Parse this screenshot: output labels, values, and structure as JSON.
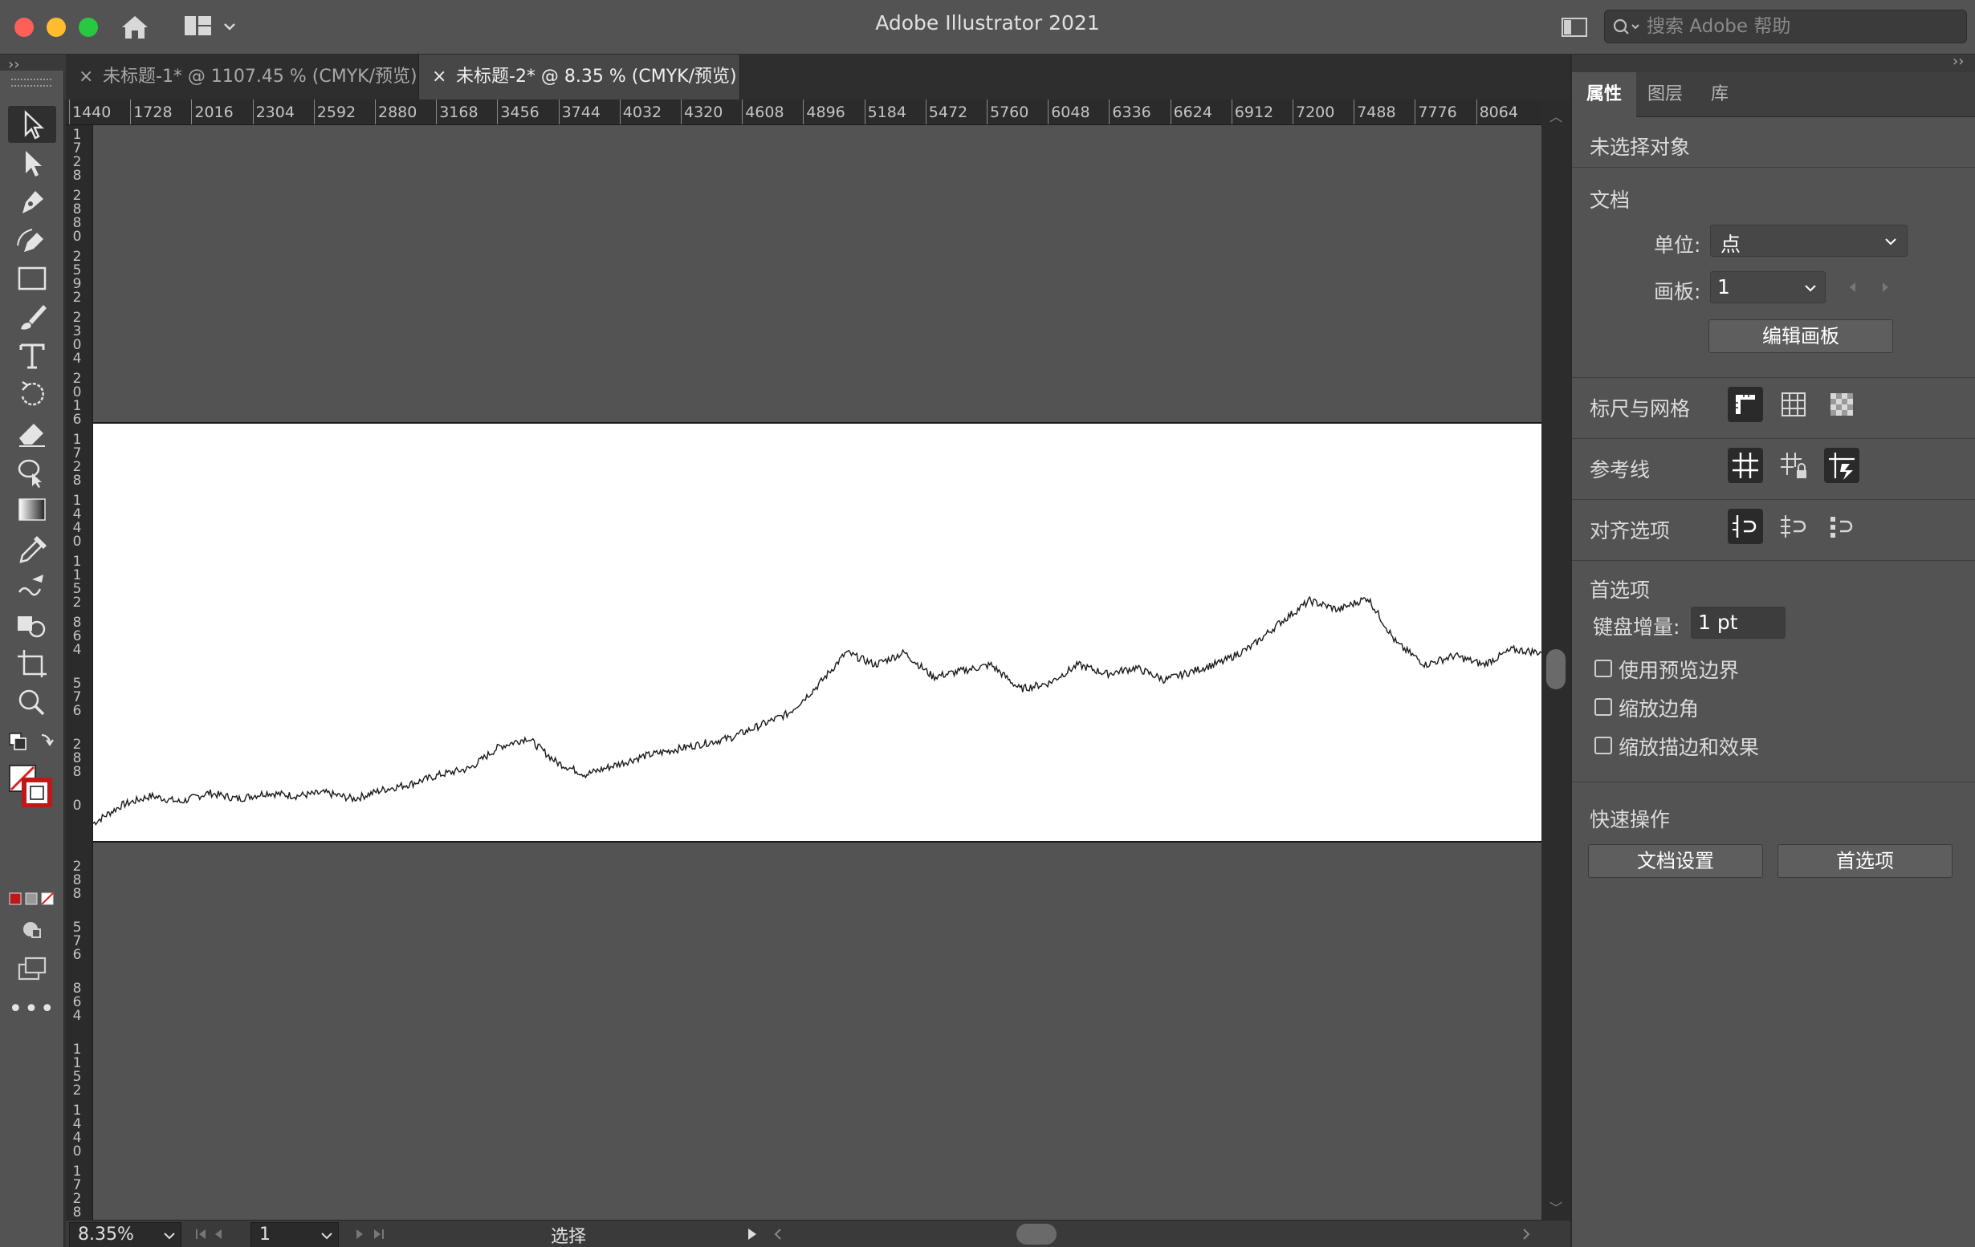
{
  "app": {
    "title": "Adobe Illustrator 2021",
    "search_placeholder": "搜索 Adobe 帮助"
  },
  "tabs": [
    {
      "label": "未标题-1* @ 1107.45 % (CMYK/预览)",
      "active": false
    },
    {
      "label": "未标题-2* @ 8.35 % (CMYK/预览)",
      "active": true
    }
  ],
  "ruler_top": [
    "1440",
    "1728",
    "2016",
    "2304",
    "2592",
    "2880",
    "3168",
    "3456",
    "3744",
    "4032",
    "4320",
    "4608",
    "4896",
    "5184",
    "5472",
    "5760",
    "6048",
    "6336",
    "6624",
    "6912",
    "7200",
    "7488",
    "7776",
    "8064"
  ],
  "ruler_left": [
    "1728",
    "2880",
    "2592",
    "2304",
    "2016",
    "1728",
    "1440",
    "1152",
    "864",
    "576",
    "288",
    "0",
    "288",
    "576",
    "864",
    "1152",
    "1440",
    "1728"
  ],
  "chart_data": {
    "type": "line",
    "series": [
      {
        "x": [
          0,
          2,
          4,
          6,
          8,
          10,
          12,
          14,
          16,
          18,
          20,
          22,
          24,
          26,
          28,
          30,
          32,
          34,
          36,
          38,
          40,
          42,
          44,
          46,
          48,
          50,
          52,
          54,
          56,
          58,
          60,
          62,
          64,
          66,
          68,
          70,
          72,
          74,
          76,
          78,
          80,
          82,
          84,
          86,
          88,
          90,
          92,
          94,
          96,
          98,
          100
        ],
        "values": [
          0.0,
          0.06,
          0.09,
          0.07,
          0.1,
          0.08,
          0.1,
          0.09,
          0.1,
          0.08,
          0.11,
          0.13,
          0.16,
          0.18,
          0.25,
          0.28,
          0.2,
          0.16,
          0.19,
          0.22,
          0.24,
          0.26,
          0.28,
          0.32,
          0.36,
          0.45,
          0.56,
          0.52,
          0.56,
          0.48,
          0.5,
          0.52,
          0.44,
          0.46,
          0.52,
          0.49,
          0.51,
          0.47,
          0.5,
          0.53,
          0.58,
          0.66,
          0.73,
          0.7,
          0.74,
          0.59,
          0.52,
          0.55,
          0.52,
          0.57,
          0.56
        ]
      }
    ],
    "colors": {
      "line": "#1a1a1a"
    }
  },
  "status": {
    "zoom": "8.35%",
    "page": "1",
    "tool": "选择"
  },
  "panel": {
    "tabs": [
      "属性",
      "图层",
      "库"
    ],
    "no_selection": "未选择对象",
    "doc_heading": "文档",
    "units_label": "单位:",
    "units_value": "点",
    "artboard_label": "画板:",
    "artboard_value": "1",
    "edit_artboard": "编辑画板",
    "rulers_grids": "标尺与网格",
    "guides": "参考线",
    "snap_options": "对齐选项",
    "prefs_heading": "首选项",
    "keyboard_inc_label": "键盘增量:",
    "keyboard_inc_value": "1 pt",
    "check_preview_bounds": "使用预览边界",
    "check_scale_corners": "缩放边角",
    "check_scale_strokes": "缩放描边和效果",
    "quick_actions": "快速操作",
    "doc_setup": "文档设置",
    "preferences": "首选项"
  }
}
